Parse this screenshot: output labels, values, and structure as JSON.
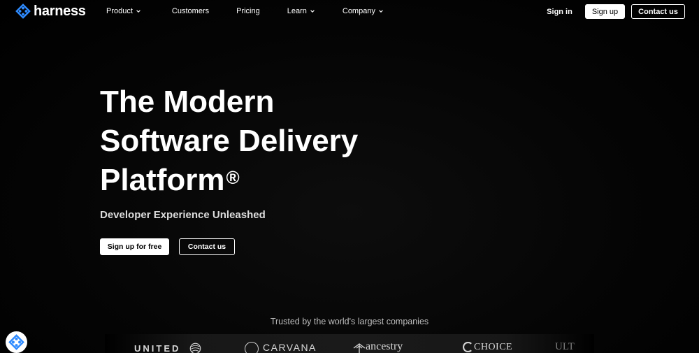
{
  "brand": {
    "name": "harness",
    "accent": "#2f8bff"
  },
  "nav": {
    "items": [
      {
        "label": "Product",
        "has_dropdown": true
      },
      {
        "label": "Customers",
        "has_dropdown": false
      },
      {
        "label": "Pricing",
        "has_dropdown": false
      },
      {
        "label": "Learn",
        "has_dropdown": true
      },
      {
        "label": "Company",
        "has_dropdown": true
      }
    ],
    "signin_label": "Sign in",
    "signup_label": "Sign up",
    "contact_label": "Contact us"
  },
  "hero": {
    "headline_line1": "The Modern",
    "headline_line2": "Software Delivery",
    "headline_line3": "Platform",
    "registered_mark": "®",
    "subtitle": "Developer Experience Unleashed",
    "primary_cta": "Sign up for free",
    "secondary_cta": "Contact us"
  },
  "trusted": {
    "heading": "Trusted by the world's largest companies",
    "logos": [
      {
        "name": "UNITED",
        "icon": "united-globe-icon"
      },
      {
        "name": "CARVANA",
        "icon": "carvana-circle-icon"
      },
      {
        "name": "ancestry",
        "icon": "ancestry-leaf-icon"
      },
      {
        "name": "CHOICE",
        "icon": "choice-c-icon"
      },
      {
        "name": "ULT",
        "icon": ""
      }
    ]
  },
  "widget": {
    "icon": "harness-chat-icon"
  },
  "colors": {
    "background": "#000000",
    "text": "#ffffff",
    "muted": "#bdbdbd"
  }
}
